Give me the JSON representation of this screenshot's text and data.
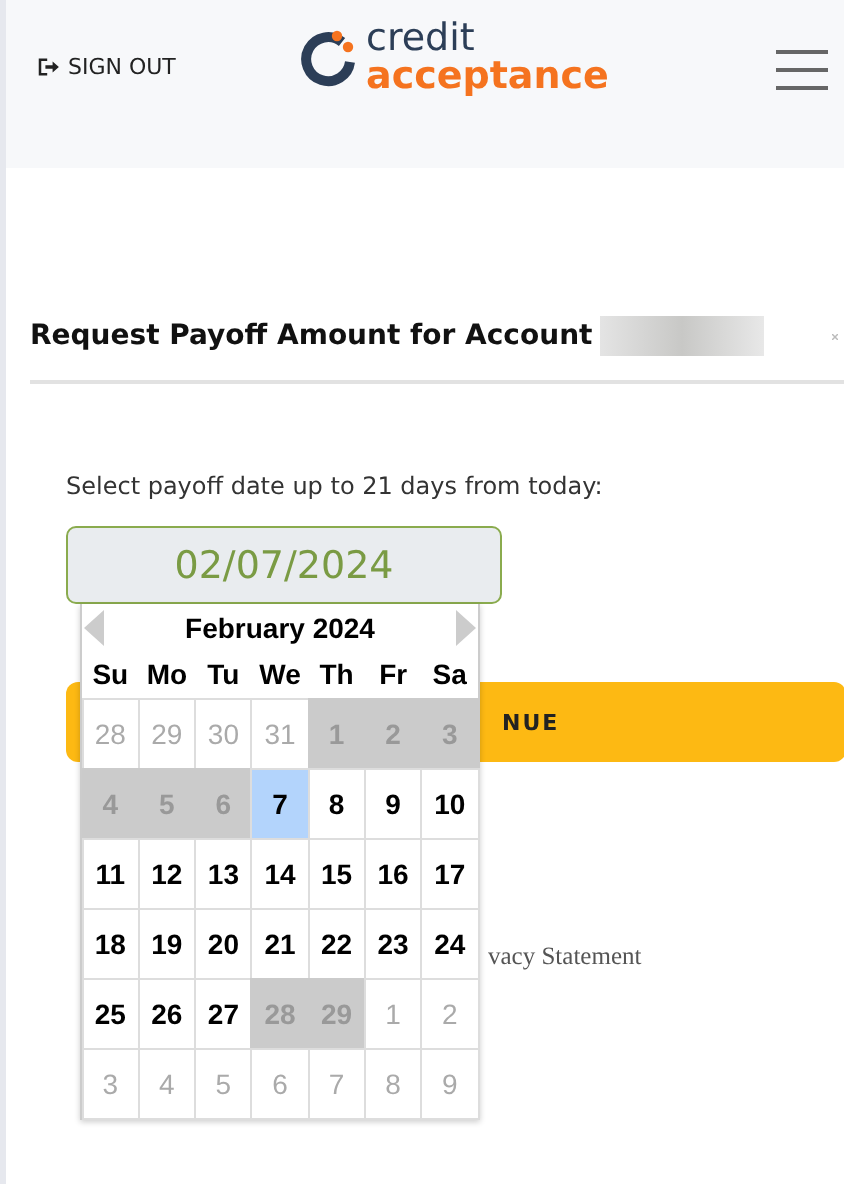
{
  "header": {
    "sign_out": "SIGN OUT",
    "logo": {
      "line1": "credit",
      "line2": "acceptance"
    }
  },
  "title": "Request Payoff Amount for Account",
  "date_label": "Select payoff date up to 21 days from today:",
  "date_field": {
    "value": "02/07/2024"
  },
  "datepicker": {
    "month": "February 2024",
    "weekdays": [
      "Su",
      "Mo",
      "Tu",
      "We",
      "Th",
      "Fr",
      "Sa"
    ],
    "days": [
      {
        "label": "28",
        "outside": true,
        "disabled": false,
        "selected": false
      },
      {
        "label": "29",
        "outside": true,
        "disabled": false,
        "selected": false
      },
      {
        "label": "30",
        "outside": true,
        "disabled": false,
        "selected": false
      },
      {
        "label": "31",
        "outside": true,
        "disabled": false,
        "selected": false
      },
      {
        "label": "1",
        "outside": false,
        "disabled": true,
        "selected": false
      },
      {
        "label": "2",
        "outside": false,
        "disabled": true,
        "selected": false
      },
      {
        "label": "3",
        "outside": false,
        "disabled": true,
        "selected": false
      },
      {
        "label": "4",
        "outside": false,
        "disabled": true,
        "selected": false
      },
      {
        "label": "5",
        "outside": false,
        "disabled": true,
        "selected": false
      },
      {
        "label": "6",
        "outside": false,
        "disabled": true,
        "selected": false
      },
      {
        "label": "7",
        "outside": false,
        "disabled": false,
        "selected": true
      },
      {
        "label": "8",
        "outside": false,
        "disabled": false,
        "selected": false
      },
      {
        "label": "9",
        "outside": false,
        "disabled": false,
        "selected": false
      },
      {
        "label": "10",
        "outside": false,
        "disabled": false,
        "selected": false
      },
      {
        "label": "11",
        "outside": false,
        "disabled": false,
        "selected": false
      },
      {
        "label": "12",
        "outside": false,
        "disabled": false,
        "selected": false
      },
      {
        "label": "13",
        "outside": false,
        "disabled": false,
        "selected": false
      },
      {
        "label": "14",
        "outside": false,
        "disabled": false,
        "selected": false
      },
      {
        "label": "15",
        "outside": false,
        "disabled": false,
        "selected": false
      },
      {
        "label": "16",
        "outside": false,
        "disabled": false,
        "selected": false
      },
      {
        "label": "17",
        "outside": false,
        "disabled": false,
        "selected": false
      },
      {
        "label": "18",
        "outside": false,
        "disabled": false,
        "selected": false
      },
      {
        "label": "19",
        "outside": false,
        "disabled": false,
        "selected": false
      },
      {
        "label": "20",
        "outside": false,
        "disabled": false,
        "selected": false
      },
      {
        "label": "21",
        "outside": false,
        "disabled": false,
        "selected": false
      },
      {
        "label": "22",
        "outside": false,
        "disabled": false,
        "selected": false
      },
      {
        "label": "23",
        "outside": false,
        "disabled": false,
        "selected": false
      },
      {
        "label": "24",
        "outside": false,
        "disabled": false,
        "selected": false
      },
      {
        "label": "25",
        "outside": false,
        "disabled": false,
        "selected": false
      },
      {
        "label": "26",
        "outside": false,
        "disabled": false,
        "selected": false
      },
      {
        "label": "27",
        "outside": false,
        "disabled": false,
        "selected": false
      },
      {
        "label": "28",
        "outside": false,
        "disabled": true,
        "selected": false
      },
      {
        "label": "29",
        "outside": false,
        "disabled": true,
        "selected": false
      },
      {
        "label": "1",
        "outside": true,
        "disabled": false,
        "selected": false
      },
      {
        "label": "2",
        "outside": true,
        "disabled": false,
        "selected": false
      },
      {
        "label": "3",
        "outside": true,
        "disabled": false,
        "selected": false
      },
      {
        "label": "4",
        "outside": true,
        "disabled": false,
        "selected": false
      },
      {
        "label": "5",
        "outside": true,
        "disabled": false,
        "selected": false
      },
      {
        "label": "6",
        "outside": true,
        "disabled": false,
        "selected": false
      },
      {
        "label": "7",
        "outside": true,
        "disabled": false,
        "selected": false
      },
      {
        "label": "8",
        "outside": true,
        "disabled": false,
        "selected": false
      },
      {
        "label": "9",
        "outside": true,
        "disabled": false,
        "selected": false
      }
    ]
  },
  "continue_button": "NUE",
  "privacy_text": "vacy Statement"
}
